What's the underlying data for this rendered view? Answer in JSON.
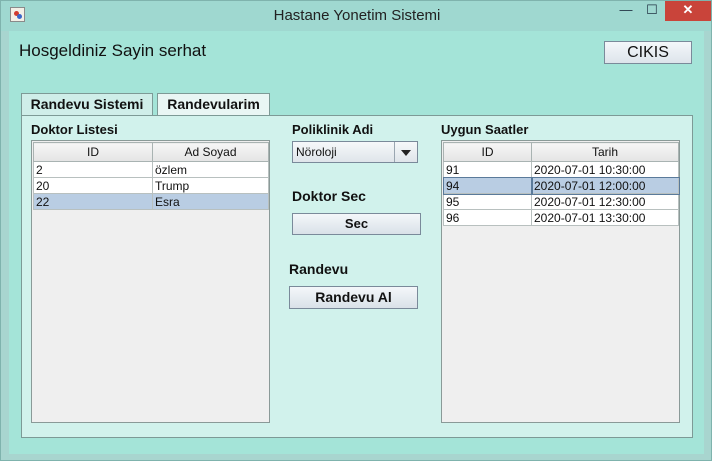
{
  "window": {
    "title": "Hastane Yonetim Sistemi"
  },
  "header": {
    "welcome": "Hosgeldiniz Sayin serhat",
    "exit_label": "CIKIS"
  },
  "tabs": [
    {
      "label": "Randevu Sistemi",
      "active": true
    },
    {
      "label": "Randevularim",
      "active": false
    }
  ],
  "doctors": {
    "title": "Doktor Listesi",
    "columns": [
      "ID",
      "Ad Soyad"
    ],
    "rows": [
      {
        "id": "2",
        "name": "özlem"
      },
      {
        "id": "20",
        "name": "Trump"
      },
      {
        "id": "22",
        "name": "Esra"
      }
    ],
    "selected_index": 2
  },
  "clinic": {
    "label": "Poliklinik Adi",
    "selected": "Nöroloji"
  },
  "doctor_select": {
    "label": "Doktor Sec",
    "button": "Sec"
  },
  "appointment": {
    "label": "Randevu",
    "button": "Randevu Al"
  },
  "slots": {
    "title": "Uygun Saatler",
    "columns": [
      "ID",
      "Tarih"
    ],
    "rows": [
      {
        "id": "91",
        "date": "2020-07-01 10:30:00"
      },
      {
        "id": "94",
        "date": "2020-07-01 12:00:00"
      },
      {
        "id": "95",
        "date": "2020-07-01 12:30:00"
      },
      {
        "id": "96",
        "date": "2020-07-01 13:30:00"
      }
    ],
    "selected_index": 1
  },
  "colors": {
    "client_bg": "#a4e4d8",
    "panel_bg": "#d1f2ec",
    "selection": "#b9cde3",
    "close_button": "#c9443a"
  },
  "icons": {
    "app": "java-app-icon",
    "minimize": "minimize-icon",
    "maximize": "maximize-icon",
    "close": "close-icon"
  }
}
